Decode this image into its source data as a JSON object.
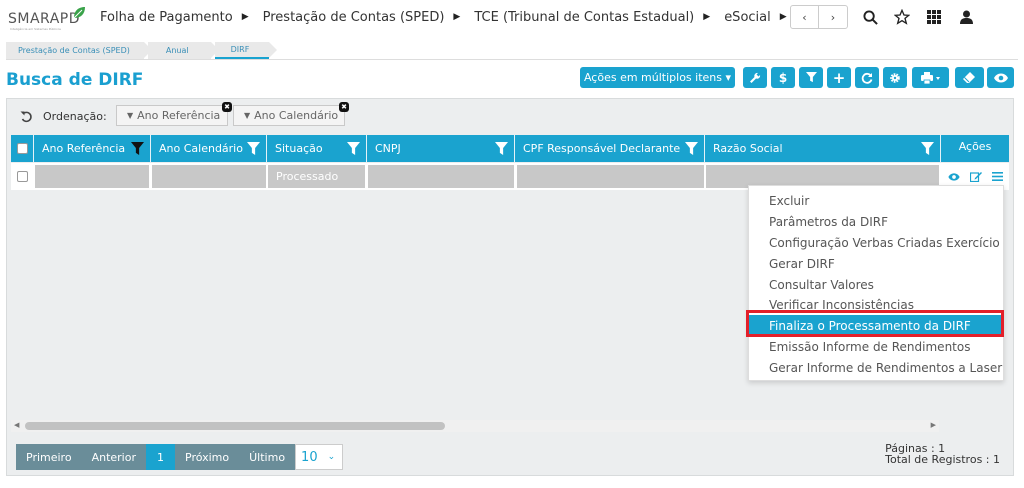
{
  "logo": {
    "text": "SMARAPD",
    "subtitle": "Inteligência em Sistemas Públicos"
  },
  "topnav": [
    {
      "label": "Folha de Pagamento"
    },
    {
      "label": "Prestação de Contas (SPED)"
    },
    {
      "label": "TCE (Tribunal de Contas Estadual)"
    },
    {
      "label": "eSocial"
    }
  ],
  "nav_arrows": {
    "prev": "‹",
    "next": "›"
  },
  "breadcrumb": [
    "Prestação de Contas (SPED)",
    "Anual",
    "DIRF"
  ],
  "page_title": "Busca de DIRF",
  "toolbar": {
    "multi_actions_label": "Ações em múltiplos itens ▾",
    "icons": [
      "wrench-icon",
      "dollar-icon",
      "filter-icon",
      "plus-icon",
      "refresh-icon",
      "gear-icon",
      "print-icon",
      "eraser-icon",
      "eye-icon"
    ],
    "dollar_glyph": "$",
    "plus_glyph": "+"
  },
  "ordering": {
    "label": "Ordenação:",
    "chips": [
      "Ano Referência",
      "Ano Calendário"
    ]
  },
  "table": {
    "columns": [
      "Ano Referência",
      "Ano Calendário",
      "Situação",
      "CNPJ",
      "CPF Responsável Declarante",
      "Razão Social",
      "Ações"
    ],
    "rows": [
      {
        "ano_referencia": "",
        "ano_calendario": "",
        "situacao": "Processado",
        "cnpj": "",
        "cpf": "",
        "razao_social": ""
      }
    ]
  },
  "context_menu": {
    "items": [
      "Excluir",
      "Parâmetros da DIRF",
      "Configuração Verbas Criadas Exercício",
      "Gerar DIRF",
      "Consultar Valores",
      "Verificar Inconsistências",
      "Finaliza o Processamento da DIRF",
      "Emissão Informe de Rendimentos",
      "Gerar Informe de Rendimentos a Laser"
    ],
    "active_item": "Finaliza o Processamento da DIRF"
  },
  "pagination": {
    "first": "Primeiro",
    "prev": "Anterior",
    "current": "1",
    "next": "Próximo",
    "last": "Último",
    "page_size": "10",
    "pages_text": "Páginas : 1",
    "total_text": "Total de Registros : 1"
  },
  "colors": {
    "accent": "#1aa3cf",
    "pager": "#6a8d99",
    "highlight": "#e3202a"
  }
}
